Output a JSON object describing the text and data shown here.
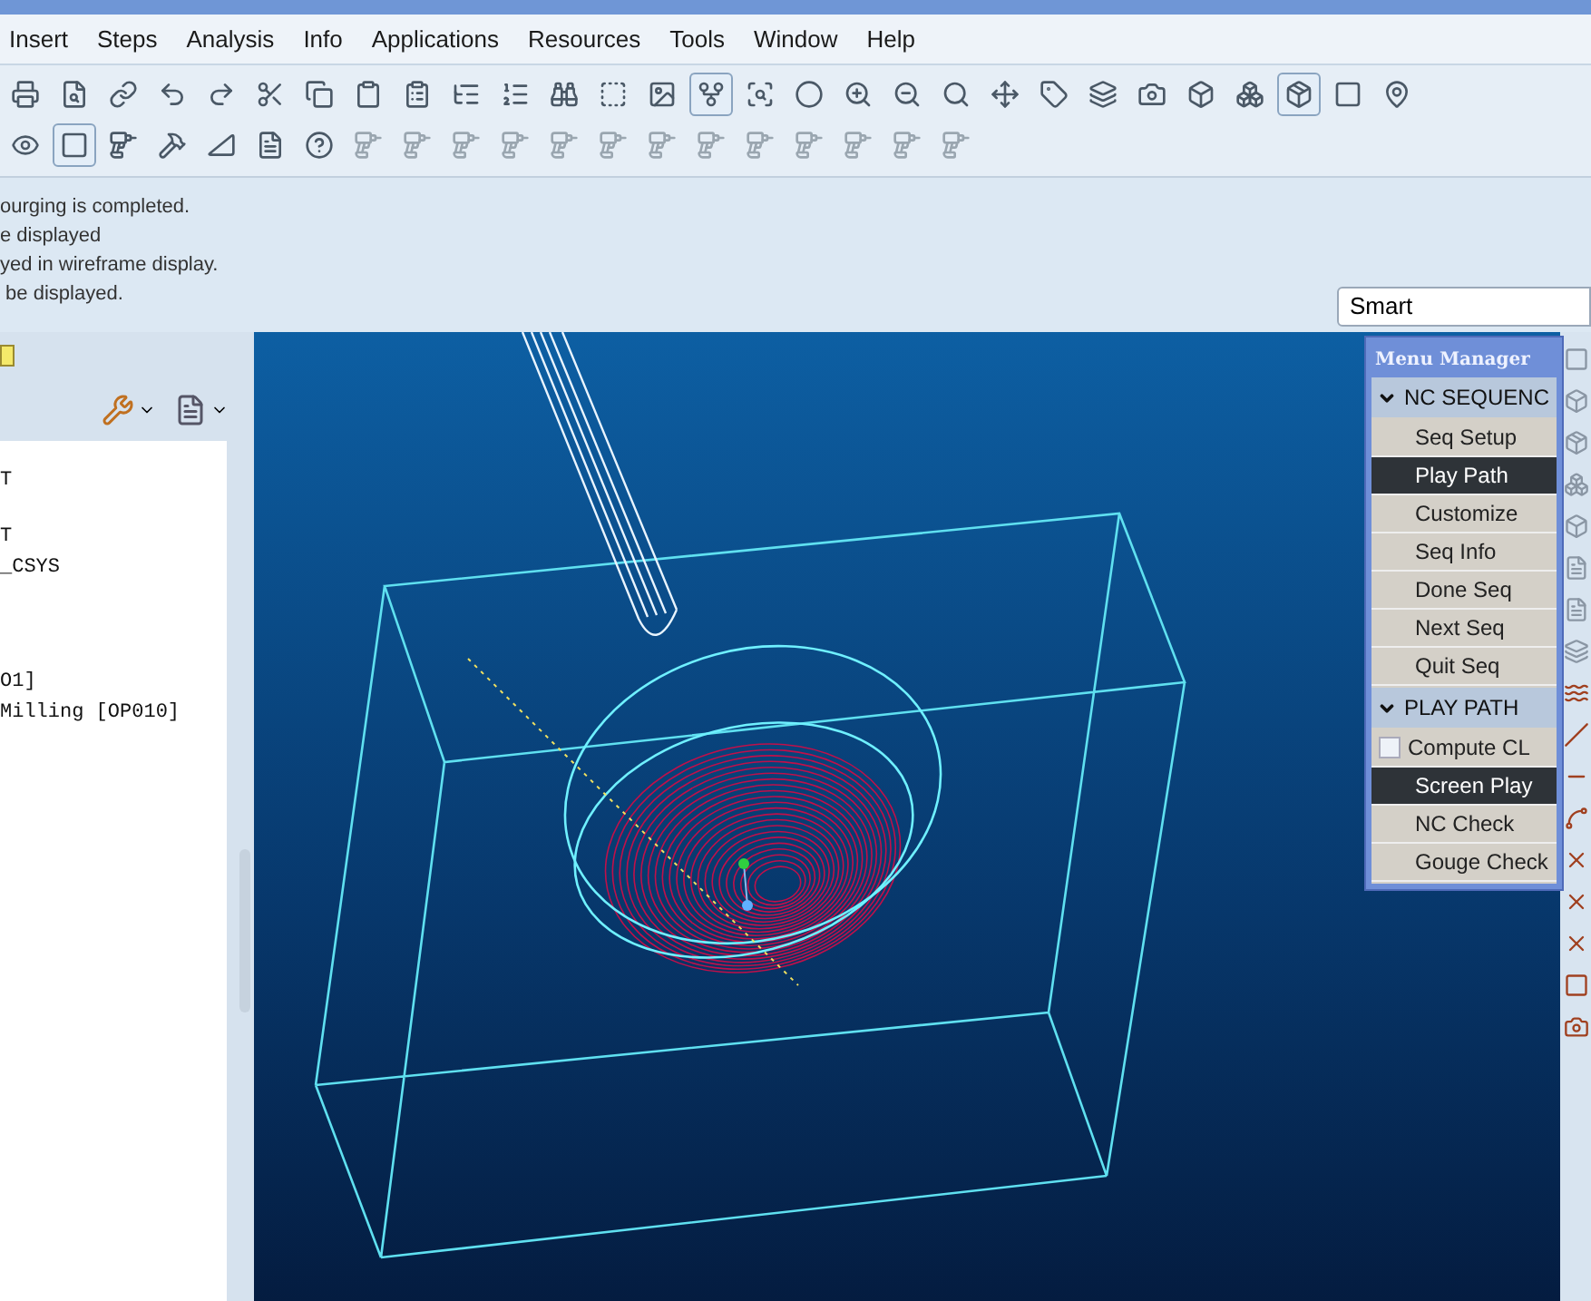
{
  "menu_bar": [
    "Insert",
    "Steps",
    "Analysis",
    "Info",
    "Applications",
    "Resources",
    "Tools",
    "Window",
    "Help"
  ],
  "toolbar_1": [
    {
      "pressed": false
    },
    {
      "pressed": false
    },
    {
      "pressed": false
    },
    {
      "pressed": false
    },
    {
      "pressed": false
    },
    {
      "pressed": false
    },
    {
      "pressed": false
    },
    {
      "pressed": false
    },
    {
      "pressed": false
    },
    {
      "pressed": false
    },
    {
      "pressed": false
    },
    {
      "pressed": false
    },
    {
      "pressed": false
    },
    {
      "pressed": false
    },
    {
      "pressed": true
    },
    {
      "pressed": false
    },
    {
      "pressed": false
    },
    {
      "pressed": false
    },
    {
      "pressed": false
    },
    {
      "pressed": false
    },
    {
      "pressed": false
    },
    {
      "pressed": false
    },
    {
      "pressed": false
    },
    {
      "pressed": false
    },
    {
      "pressed": false
    },
    {
      "pressed": false
    },
    {
      "pressed": true
    },
    {
      "pressed": false
    },
    {
      "pressed": false
    }
  ],
  "toolbar_2": [
    {
      "pressed": false
    },
    {
      "pressed": true
    },
    {
      "pressed": false
    },
    {
      "pressed": false
    },
    {
      "pressed": false
    },
    {
      "pressed": false
    },
    {
      "pressed": false
    },
    {
      "pressed": false
    },
    {
      "pressed": false
    },
    {
      "pressed": false
    },
    {
      "pressed": false
    },
    {
      "pressed": false
    },
    {
      "pressed": false
    },
    {
      "pressed": false
    },
    {
      "pressed": false
    },
    {
      "pressed": false
    },
    {
      "pressed": false
    },
    {
      "pressed": false
    },
    {
      "pressed": false
    },
    {
      "pressed": false
    }
  ],
  "messages": [
    "ourging is completed.",
    "e displayed",
    "yed in wireframe display.",
    " be displayed."
  ],
  "filter": {
    "value": "Smart"
  },
  "model_tree": [
    "T",
    "T",
    "_CSYS",
    "O1]",
    "Milling [OP010]"
  ],
  "menu_manager": {
    "title": "Menu Manager",
    "sections": [
      {
        "header": "NC SEQUENC",
        "items": [
          {
            "kind": "item",
            "label": "Seq Setup",
            "selected": false
          },
          {
            "kind": "item",
            "label": "Play Path",
            "selected": true
          },
          {
            "kind": "item",
            "label": "Customize",
            "selected": false
          },
          {
            "kind": "item",
            "label": "Seq Info",
            "selected": false
          },
          {
            "kind": "item",
            "label": "Done Seq",
            "selected": false
          },
          {
            "kind": "item",
            "label": "Next Seq",
            "selected": false
          },
          {
            "kind": "item",
            "label": "Quit Seq",
            "selected": false
          }
        ]
      },
      {
        "header": "PLAY PATH",
        "items": [
          {
            "kind": "checkbox",
            "label": "Compute CL",
            "checked": false,
            "selected": false
          },
          {
            "kind": "item",
            "label": "Screen Play",
            "selected": true
          },
          {
            "kind": "item",
            "label": "NC Check",
            "selected": false
          },
          {
            "kind": "item",
            "label": "Gouge Check",
            "selected": false
          }
        ]
      }
    ]
  }
}
